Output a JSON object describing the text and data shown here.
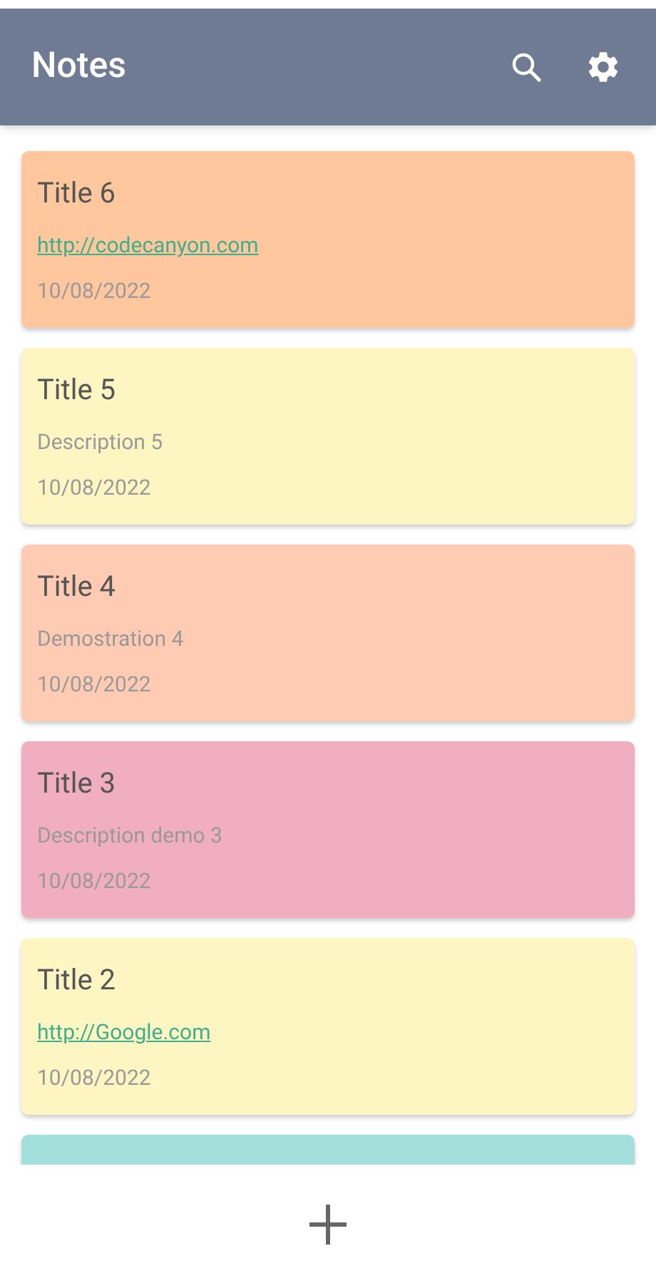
{
  "app_bar": {
    "title": "Notes"
  },
  "notes": [
    {
      "title": "Title 6",
      "body": "http://codecanyon.com",
      "kind": "link",
      "date": "10/08/2022",
      "color": "#ffc79d"
    },
    {
      "title": "Title 5",
      "body": "Description 5",
      "kind": "text",
      "date": "10/08/2022",
      "color": "#fdf6c3"
    },
    {
      "title": "Title 4",
      "body": "Demostration 4",
      "kind": "text",
      "date": "10/08/2022",
      "color": "#ffcbb2"
    },
    {
      "title": "Title 3",
      "body": "Description demo 3",
      "kind": "text",
      "date": "10/08/2022",
      "color": "#f2aec1"
    },
    {
      "title": "Title 2",
      "body": "http://Google.com",
      "kind": "link",
      "date": "10/08/2022",
      "color": "#fdf6c3"
    },
    {
      "kind": "partial",
      "color": "#a3e0dc"
    }
  ]
}
